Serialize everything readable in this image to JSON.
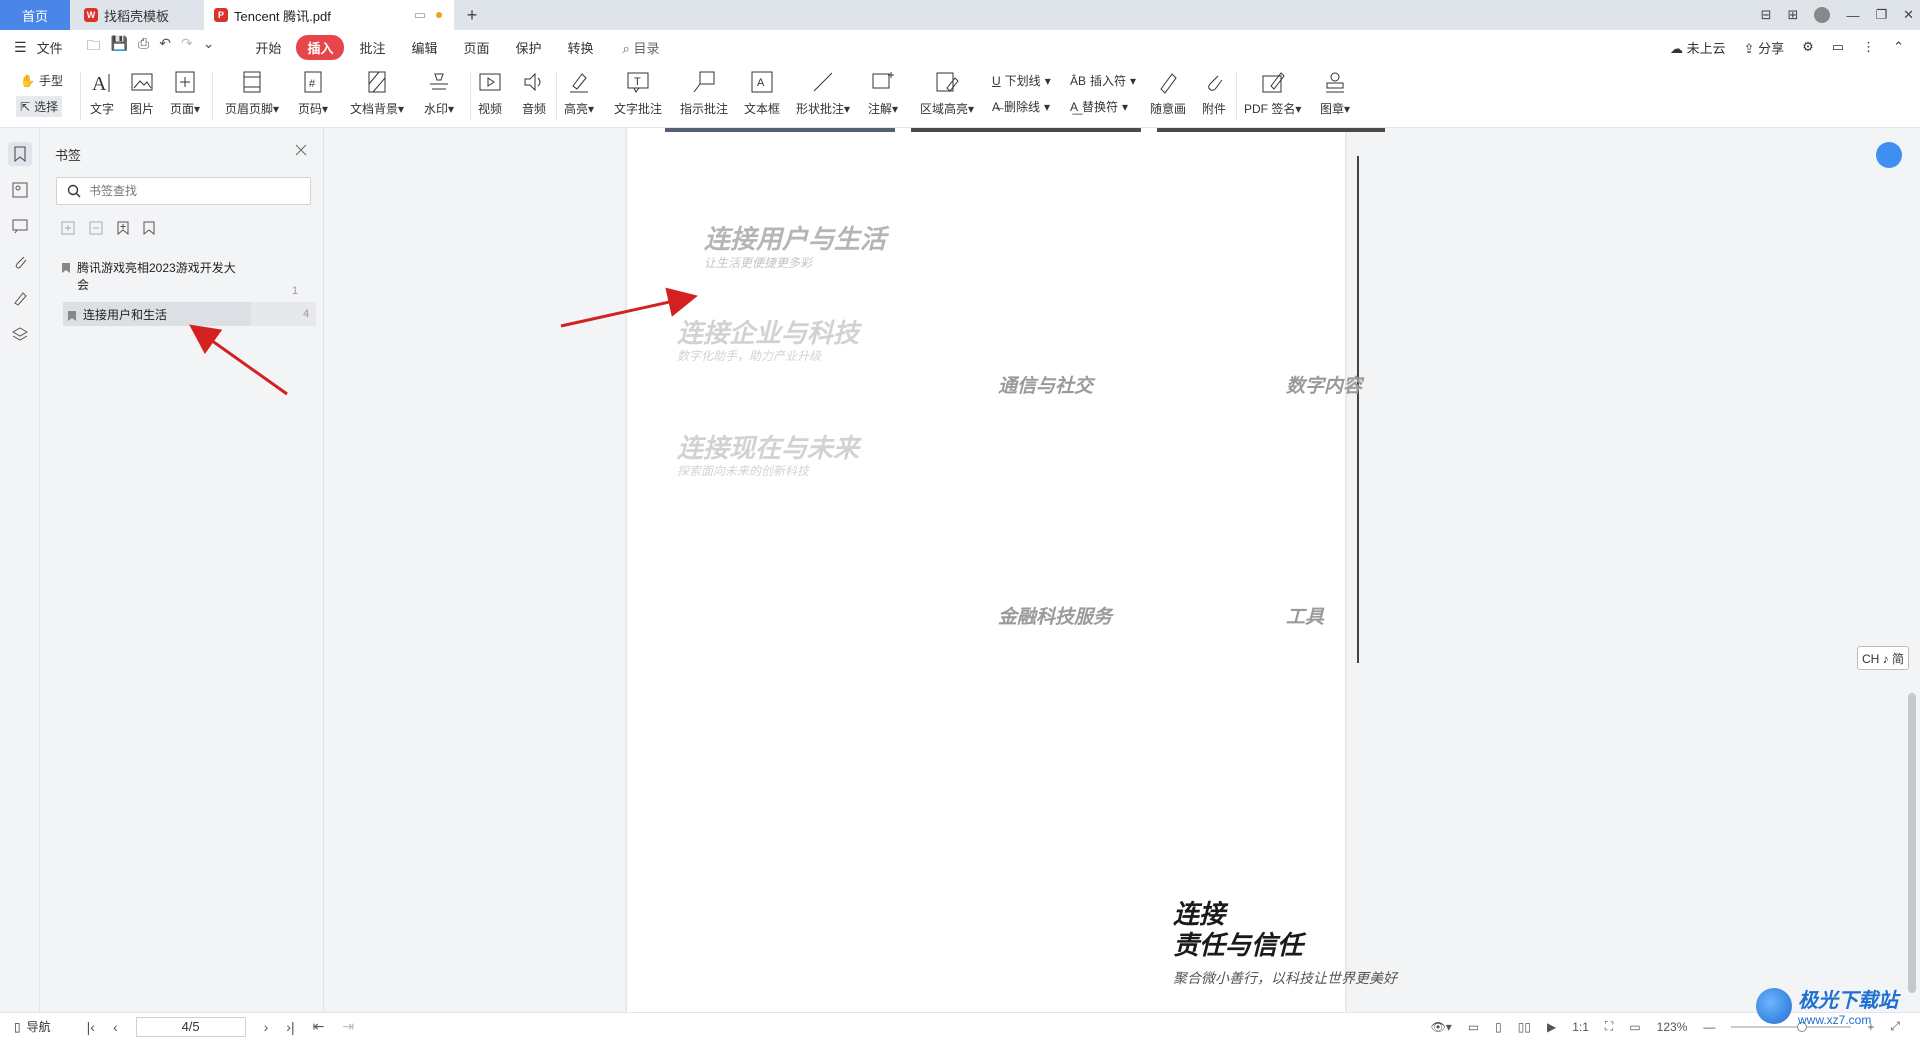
{
  "tabs": {
    "home": "首页",
    "template": "找稻壳模板",
    "active": "Tencent 腾讯.pdf",
    "new_tab": "+"
  },
  "menu": {
    "file": "文件",
    "tabs": [
      "开始",
      "插入",
      "批注",
      "编辑",
      "页面",
      "保护",
      "转换"
    ],
    "active_tab": "插入",
    "search": "目录",
    "cloud": "未上云",
    "share": "分享"
  },
  "ribbon": {
    "hand": "手型",
    "select": "选择",
    "text": "文字",
    "image": "图片",
    "page": "页面",
    "header_footer": "页眉页脚",
    "page_number": "页码",
    "doc_background": "文档背景",
    "watermark": "水印",
    "video": "视频",
    "audio": "音频",
    "highlight": "高亮",
    "text_annotation": "文字批注",
    "pointer_annotation": "指示批注",
    "textbox": "文本框",
    "shape_annotation": "形状批注",
    "note": "注解",
    "area_highlight": "区域高亮",
    "underline": "下划线",
    "strikethrough": "删除线",
    "insert_symbol": "插入符",
    "replace_symbol": "替换符",
    "freehand": "随意画",
    "attachment": "附件",
    "pdf_sign": "PDF 签名",
    "stamp": "图章"
  },
  "bookmarks": {
    "title": "书签",
    "search_placeholder": "书签查找",
    "items": [
      {
        "label": "腾讯游戏亮相2023游戏开发大会",
        "page": "1"
      },
      {
        "label": "连接用户和生活",
        "page": "4"
      }
    ]
  },
  "document": {
    "heading1": "连接用户与生活",
    "sub1": "让生活更便捷更多彩",
    "heading2": "连接企业与科技",
    "sub2": "数字化助手，助力产业升级",
    "heading3": "连接现在与未来",
    "sub3": "探索面向未来的创新科技",
    "cat1": "通信与社交",
    "cat2": "数字内容",
    "cat3": "金融科技服务",
    "cat4": "工具",
    "bottom_line1": "连接",
    "bottom_line2": "责任与信任",
    "bottom_tagline": "聚合微小善行，以科技让世界更美好"
  },
  "ime": "CH ♪ 简",
  "status": {
    "nav": "导航",
    "page_value": "4/5",
    "zoom": "123%"
  },
  "watermark": {
    "name": "极光下载站",
    "url": "www.xz7.com"
  },
  "colors": {
    "accent": "#4a86e8",
    "active_tab": "#e8454a",
    "arrow": "#d42020"
  }
}
